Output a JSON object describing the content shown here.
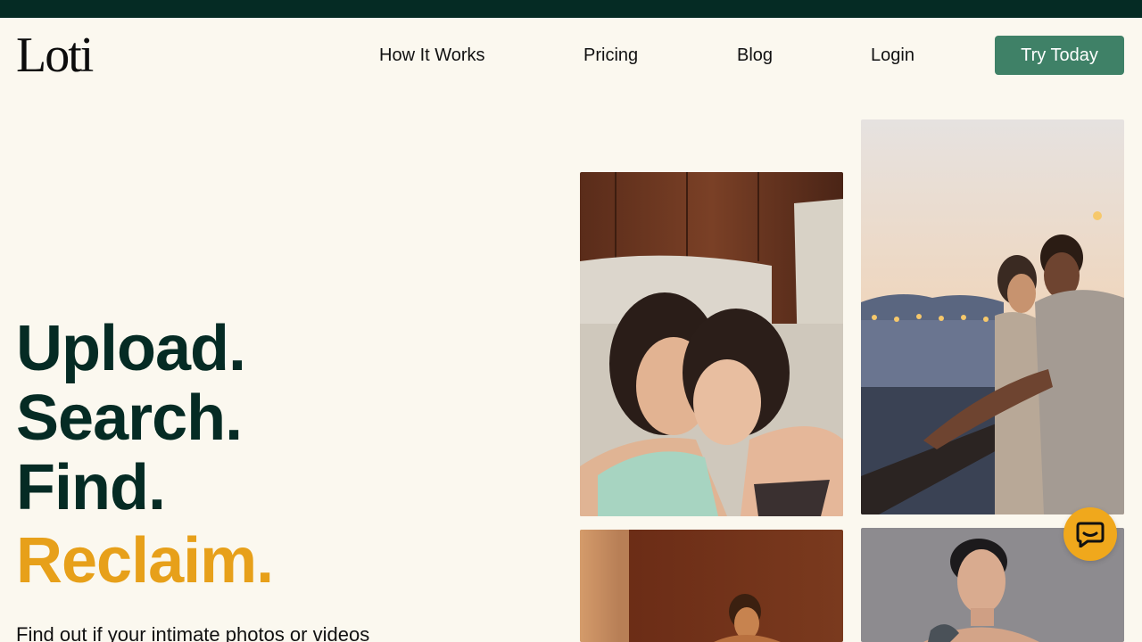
{
  "header": {
    "logo_text": "Loti",
    "nav": [
      {
        "label": "How It Works"
      },
      {
        "label": "Pricing"
      },
      {
        "label": "Blog"
      },
      {
        "label": "Login"
      }
    ],
    "cta_label": "Try Today"
  },
  "hero": {
    "lines": [
      "Upload.",
      "Search.",
      "Find.",
      "Reclaim."
    ],
    "subtext": "Find out if your intimate photos or videos"
  },
  "photos": [
    {
      "name": "couple-women-in-bed-photo"
    },
    {
      "name": "couple-at-waterfront-railing-photo"
    },
    {
      "name": "woman-in-warm-wood-room-photo"
    },
    {
      "name": "short-haired-person-portrait-photo"
    }
  ],
  "chat": {
    "icon": "chat-bubble-icon"
  },
  "colors": {
    "topbar": "#052b24",
    "background": "#fbf8ef",
    "heading": "#052b24",
    "accent": "#e7a01a",
    "cta": "#3f8167",
    "chat": "#f0a81c"
  }
}
